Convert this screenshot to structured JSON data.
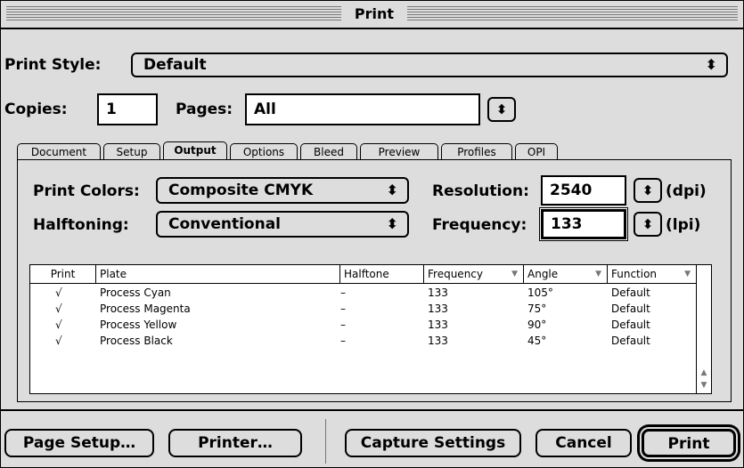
{
  "window": {
    "title": "Print"
  },
  "print_style": {
    "label": "Print Style:",
    "value": "Default",
    "arrow": "⬍"
  },
  "copies": {
    "label": "Copies:",
    "value": "1"
  },
  "pages": {
    "label": "Pages:",
    "value": "All",
    "arrow": "⬍"
  },
  "tabs": [
    {
      "label": "Document"
    },
    {
      "label": "Setup"
    },
    {
      "label": "Output",
      "active": true
    },
    {
      "label": "Options"
    },
    {
      "label": "Bleed"
    },
    {
      "label": "Preview"
    },
    {
      "label": "Profiles"
    },
    {
      "label": "OPI"
    }
  ],
  "output": {
    "print_colors": {
      "label": "Print Colors:",
      "value": "Composite CMYK"
    },
    "halftoning": {
      "label": "Halftoning:",
      "value": "Conventional"
    },
    "resolution": {
      "label": "Resolution:",
      "value": "2540",
      "unit": "(dpi)"
    },
    "frequency": {
      "label": "Frequency:",
      "value": "133",
      "unit": "(lpi)"
    }
  },
  "plates": {
    "headers": [
      "Print",
      "Plate",
      "Halftone",
      "Frequency",
      "Angle",
      "Function"
    ],
    "sort_glyph": "▼",
    "rows": [
      {
        "print": "√",
        "plate": "Process Cyan",
        "halftone": "–",
        "frequency": "133",
        "angle": "105°",
        "function": "Default"
      },
      {
        "print": "√",
        "plate": "Process Magenta",
        "halftone": "–",
        "frequency": "133",
        "angle": "75°",
        "function": "Default"
      },
      {
        "print": "√",
        "plate": "Process Yellow",
        "halftone": "–",
        "frequency": "133",
        "angle": "90°",
        "function": "Default"
      },
      {
        "print": "√",
        "plate": "Process Black",
        "halftone": "–",
        "frequency": "133",
        "angle": "45°",
        "function": "Default"
      }
    ],
    "scroll_up": "▲",
    "scroll_down": "▼"
  },
  "buttons": {
    "page_setup": "Page Setup…",
    "printer": "Printer…",
    "capture_settings": "Capture Settings",
    "cancel": "Cancel",
    "print": "Print"
  },
  "colors": {
    "background": "#dddddd",
    "border": "#000000",
    "field": "#ffffff"
  }
}
